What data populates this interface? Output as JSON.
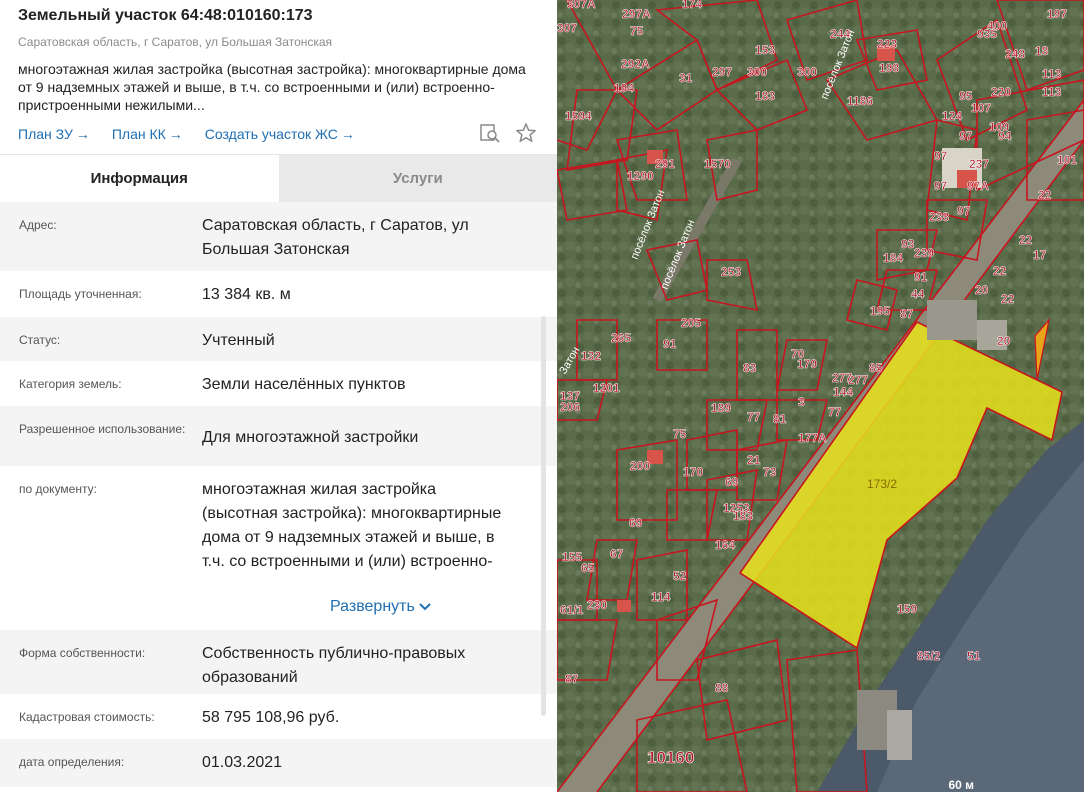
{
  "parcel": {
    "title": "Земельный участок 64:48:010160:173",
    "address_short": "Саратовская область, г Саратов, ул Большая Затонская",
    "description": "многоэтажная жилая застройка (высотная застройка): многоквартирные дома от 9 надземных этажей и выше, в т.ч. со встроенными и (или) встроенно-пристроенными нежилыми..."
  },
  "links": [
    {
      "label": "План ЗУ",
      "arrow": "→"
    },
    {
      "label": "План КК",
      "arrow": "→"
    },
    {
      "label": "Создать участок ЖС",
      "arrow": "→"
    }
  ],
  "header_icons": [
    "search-document-icon",
    "star-icon"
  ],
  "tabs": [
    {
      "label": "Информация",
      "active": true
    },
    {
      "label": "Услуги",
      "active": false
    }
  ],
  "info_rows": [
    {
      "label": "Адрес:",
      "value": "Саратовская область, г Саратов, ул Большая Затонская"
    },
    {
      "label": "Площадь уточненная:",
      "value": "13 384 кв. м"
    },
    {
      "label": "Статус:",
      "value": "Учтенный"
    },
    {
      "label": "Категория земель:",
      "value": "Земли населённых пунктов"
    },
    {
      "label": "Разрешенное использование:",
      "value": "Для многоэтажной застройки"
    },
    {
      "label": "по документу:",
      "value": "многоэтажная жилая застройка (высотная застройка): многоквартирные дома от 9 надземных этажей и выше, в т.ч. со встроенными и (или) встроенно-"
    },
    {
      "label": "Форма собственности:",
      "value": "Собственность публично-правовых образований"
    },
    {
      "label": "Кадастровая стоимость:",
      "value": "58 795 108,96 руб."
    },
    {
      "label": "дата определения:",
      "value": "01.03.2021"
    }
  ],
  "expand_label": "Развернуть",
  "map": {
    "selected_parcel_label": "173/2",
    "block_label": "10160",
    "street_labels": [
      "посёлок Затон",
      "посёлок Затон",
      "посёлок Затон",
      "Затон"
    ],
    "parcel_labels": [
      "307А",
      "297А",
      "174",
      "197",
      "307",
      "153",
      "244",
      "223",
      "400",
      "935",
      "248",
      "18",
      "113",
      "75",
      "292А",
      "31",
      "297",
      "300",
      "300",
      "198",
      "113",
      "1594",
      "194",
      "183",
      "1186",
      "95",
      "220",
      "107",
      "124",
      "97",
      "109",
      "94",
      "101",
      "291",
      "1570",
      "97",
      "237",
      "97А",
      "1290",
      "97",
      "22",
      "97",
      "238",
      "93",
      "239",
      "22",
      "17",
      "253",
      "184",
      "91",
      "22",
      "44",
      "20",
      "22",
      "195",
      "87",
      "20",
      "265",
      "132",
      "205",
      "91",
      "70",
      "179",
      "85",
      "277",
      "1201",
      "83",
      "277",
      "137",
      "206",
      "189",
      "77",
      "81",
      "3",
      "144",
      "77",
      "177А",
      "75",
      "170",
      "200",
      "21",
      "73",
      "69",
      "1253",
      "183",
      "69",
      "164",
      "67",
      "155",
      "65",
      "52",
      "114",
      "230",
      "61/1",
      "159",
      "88",
      "87",
      "85/2",
      "51"
    ],
    "scale_label": "60 м"
  },
  "colors": {
    "accent": "#1f6fb2",
    "parcel_border": "#c8141e",
    "selected_fill": "#e8e21a"
  }
}
